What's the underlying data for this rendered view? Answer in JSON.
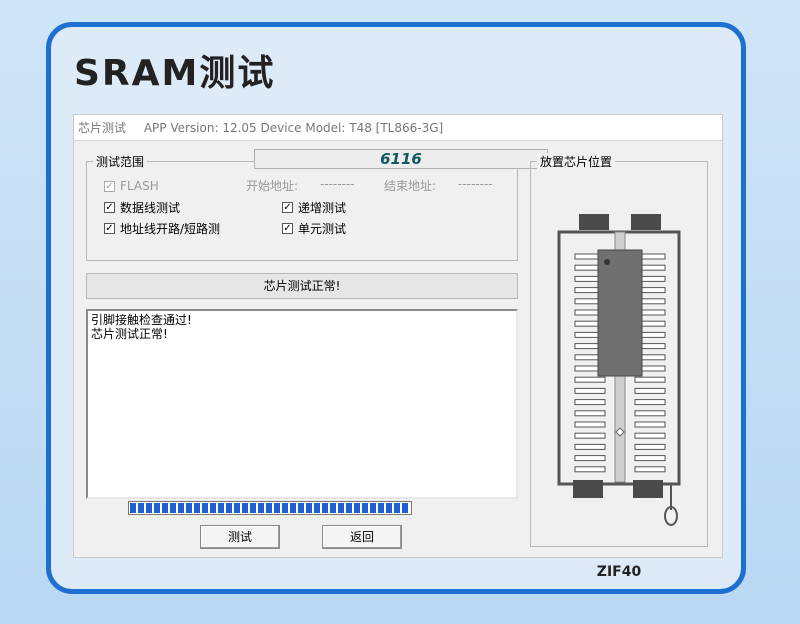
{
  "page": {
    "heading": "SRAM测试"
  },
  "window": {
    "title": "芯片测试",
    "app_version": "APP Version: 12.05 Device Model: T48 [TL866-3G]"
  },
  "test_range": {
    "title": "测试范围",
    "chip_name": "6116",
    "options": {
      "flash": {
        "label": "FLASH",
        "checked": true,
        "disabled": true
      },
      "data_line": {
        "label": "数据线测试",
        "checked": true
      },
      "addr_line": {
        "label": "地址线开路/短路测",
        "checked": true
      },
      "increment": {
        "label": "递增测试",
        "checked": true
      },
      "cell": {
        "label": "单元测试",
        "checked": true
      }
    },
    "start_addr_label": "开始地址:",
    "start_addr_value": "--------",
    "end_addr_label": "结束地址:",
    "end_addr_value": "--------"
  },
  "status": {
    "text": "芯片测试正常!"
  },
  "log": {
    "line1": "引脚接触检查通过!",
    "line2": "芯片测试正常!"
  },
  "progress": {
    "value": 1.0
  },
  "buttons": {
    "test": "测试",
    "back": "返回"
  },
  "placement": {
    "title": "放置芯片位置",
    "socket_label": "ZIF40"
  },
  "colors": {
    "accent": "#1d6fd0",
    "progress": "#1e5fd6",
    "chip_name": "#0f5a5e"
  }
}
